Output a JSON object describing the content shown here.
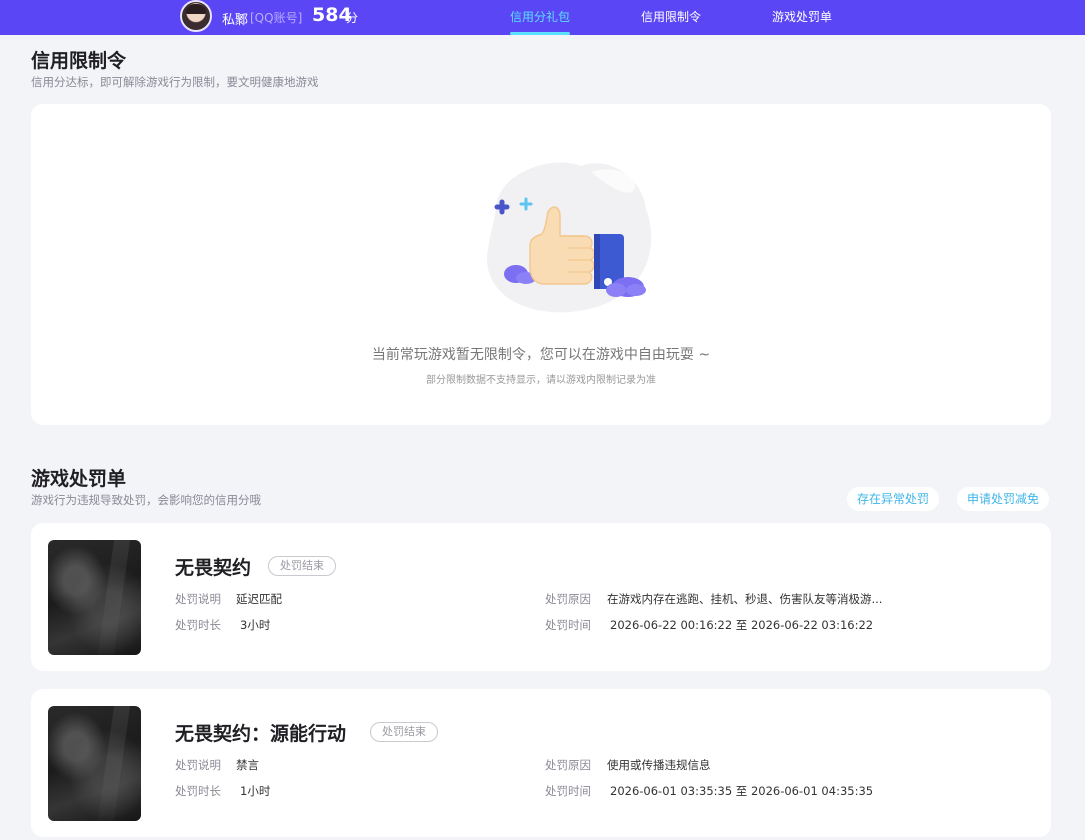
{
  "topbar": {
    "username": "私鄹",
    "account_type": "[QQ账号]",
    "score": "584",
    "score_unit": "分",
    "tabs": [
      "信用分礼包",
      "信用限制令",
      "游戏处罚单"
    ],
    "active_tab": "信用分礼包",
    "color": "#5a46f5",
    "accent": "#5ce0ff"
  },
  "restriction": {
    "title": "信用限制令",
    "subtitle": "信用分达标，即可解除游戏行为限制，要文明健康地游戏",
    "empty_text": "当前常玩游戏暂无限制令，您可以在游戏中自由玩耍 ~",
    "empty_note": "部分限制数据不支持显示，请以游戏内限制记录为准"
  },
  "penalties": {
    "title": "游戏处罚单",
    "subtitle": "游戏行为违规导致处罚，会影响您的信用分哦",
    "btn_abnormal": "存在异常处罚",
    "btn_appeal": "申请处罚减免",
    "labels": {
      "desc": "处罚说明",
      "duration": "处罚时长",
      "reason": "处罚原因",
      "time": "处罚时间"
    },
    "items": [
      {
        "game": "无畏契约",
        "status": "处罚结束",
        "desc": "延迟匹配",
        "duration": "3小时",
        "reason": "在游戏内存在逃跑、挂机、秒退、伤害队友等消极游...",
        "time": "2026-06-22 00:16:22 至 2026-06-22 03:16:22"
      },
      {
        "game": "无畏契约：源能行动",
        "status": "处罚结束",
        "desc": "禁言",
        "duration": "1小时",
        "reason": "使用或传播违规信息",
        "time": "2026-06-01 03:35:35 至 2026-06-01 04:35:35"
      }
    ]
  },
  "icons": [
    "avatar",
    "thumbs-up-illustration",
    "game-cover-thumbnail"
  ]
}
